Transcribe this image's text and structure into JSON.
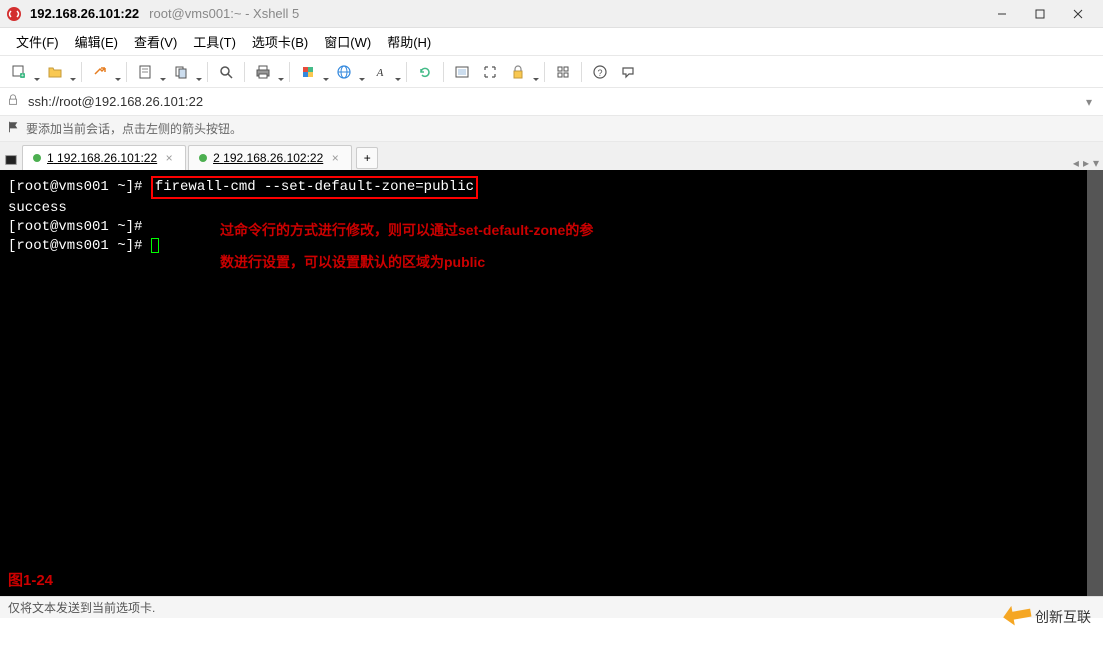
{
  "titlebar": {
    "title": "192.168.26.101:22",
    "subtitle": "root@vms001:~ - Xshell 5"
  },
  "menu": {
    "file": "文件(F)",
    "edit": "编辑(E)",
    "view": "查看(V)",
    "tools": "工具(T)",
    "tabs": "选项卡(B)",
    "window": "窗口(W)",
    "help": "帮助(H)"
  },
  "toolbar_icons": {
    "new_session": "new-session-icon",
    "open": "open-icon",
    "save": "save-icon",
    "properties": "properties-icon",
    "copy": "copy-icon",
    "paste": "paste-icon",
    "find": "find-icon",
    "print": "print-icon",
    "color": "color-icon",
    "globe": "globe-icon",
    "font": "font-icon",
    "refresh": "refresh-icon",
    "fullscreen": "fullscreen-icon",
    "fit": "fit-icon",
    "lock": "lock-icon",
    "sessions": "sessions-icon",
    "help": "help-icon",
    "speech": "speech-icon"
  },
  "addressbar": {
    "text": "ssh://root@192.168.26.101:22"
  },
  "infobar": {
    "text": "要添加当前会话，点击左侧的箭头按钮。"
  },
  "tabs": [
    {
      "num": "1",
      "label": "192.168.26.101:22",
      "active": true
    },
    {
      "num": "2",
      "label": "192.168.26.102:22",
      "active": false
    }
  ],
  "terminal": {
    "line1_prompt": "[root@vms001 ~]# ",
    "line1_cmd": "firewall-cmd --set-default-zone=public",
    "line2": "success",
    "line3": "[root@vms001 ~]# ",
    "line4": "[root@vms001 ~]# ",
    "annotation1": "过命令行的方式进行修改，则可以通过set-default-zone的参",
    "annotation2": "数进行设置，可以设置默认的区域为public",
    "figure_label": "图1-24"
  },
  "statusbar": {
    "text": "仅将文本发送到当前选项卡."
  },
  "watermark": {
    "text": "创新互联"
  }
}
